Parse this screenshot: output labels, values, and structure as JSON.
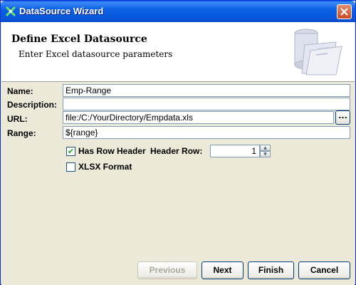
{
  "window": {
    "title": "DataSource Wizard"
  },
  "header": {
    "title": "Define Excel Datasource",
    "subtitle": "Enter Excel datasource parameters"
  },
  "form": {
    "name_label": "Name:",
    "name_value": "Emp-Range",
    "description_label": "Description:",
    "description_value": "",
    "url_label": "URL:",
    "url_value": "file:/C:/YourDirectory/Empdata.xls",
    "browse_label": "...",
    "range_label": "Range:",
    "range_value": "${range}",
    "has_row_header_label": "Has Row Header",
    "has_row_header_checked": true,
    "header_row_label": "Header Row:",
    "header_row_value": "1",
    "xlsx_label": "XLSX Format",
    "xlsx_checked": false
  },
  "footer": {
    "previous": "Previous",
    "next": "Next",
    "finish": "Finish",
    "cancel": "Cancel"
  }
}
